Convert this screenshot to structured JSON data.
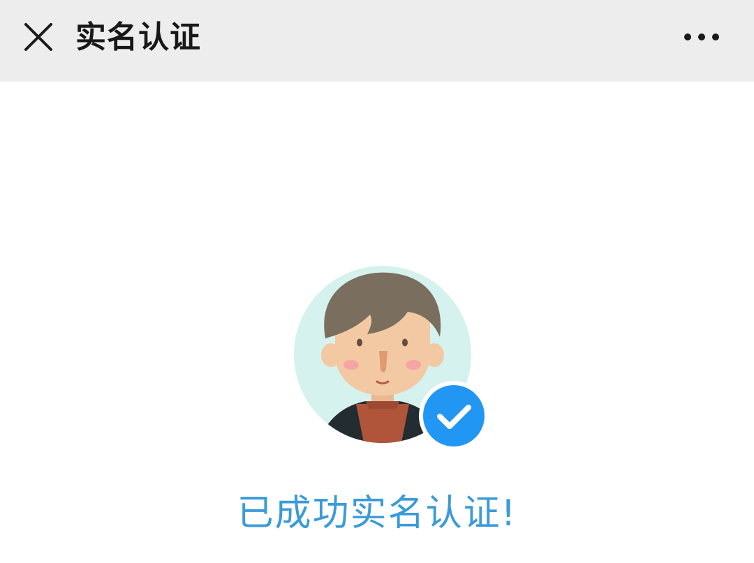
{
  "header": {
    "title": "实名认证",
    "close_icon": "close-icon",
    "more_icon": "more-dots-icon"
  },
  "main": {
    "avatar_icon": "user-avatar-illustration",
    "verified_icon": "check-circle-icon",
    "status_text": "已成功实名认证!"
  },
  "colors": {
    "header_bg": "#ededed",
    "accent_blue": "#2196f3",
    "status_text": "#3b9bd8",
    "avatar_bg": "#d6f2ee",
    "hair": "#7a6e5e",
    "skin": "#f2c9a2",
    "shirt": "#b0553a",
    "jacket": "#232c30"
  }
}
